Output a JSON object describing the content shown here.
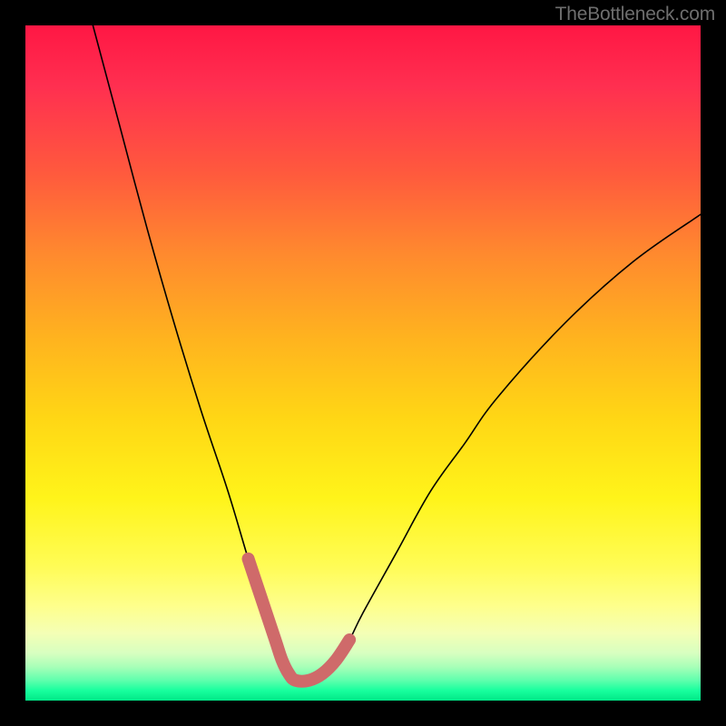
{
  "watermark": "TheBottleneck.com",
  "chart_data": {
    "type": "line",
    "title": "",
    "xlabel": "",
    "ylabel": "",
    "xlim": [
      0,
      100
    ],
    "ylim": [
      0,
      100
    ],
    "series": [
      {
        "name": "bottleneck-curve",
        "x": [
          10,
          14,
          18,
          22,
          26,
          30,
          33,
          35,
          37,
          38,
          39,
          40,
          42,
          44,
          46,
          48,
          50,
          55,
          60,
          65,
          70,
          80,
          90,
          100
        ],
        "values": [
          100,
          85,
          70,
          56,
          43,
          31,
          21,
          15,
          9,
          6,
          4,
          3,
          3,
          4,
          6,
          9,
          13,
          22,
          31,
          38,
          45,
          56,
          65,
          72
        ]
      },
      {
        "name": "highlight-region",
        "x": [
          33,
          35,
          37,
          38,
          39,
          40,
          42,
          44,
          46,
          48
        ],
        "values": [
          21,
          15,
          9,
          6,
          4,
          3,
          3,
          4,
          6,
          9
        ]
      }
    ],
    "gradient_stops": [
      {
        "pos": 0,
        "color": "#ff1744"
      },
      {
        "pos": 0.09,
        "color": "#ff2f50"
      },
      {
        "pos": 0.22,
        "color": "#ff5a3d"
      },
      {
        "pos": 0.34,
        "color": "#ff8a2e"
      },
      {
        "pos": 0.46,
        "color": "#ffb21f"
      },
      {
        "pos": 0.58,
        "color": "#ffd615"
      },
      {
        "pos": 0.7,
        "color": "#fff41a"
      },
      {
        "pos": 0.8,
        "color": "#fffc55"
      },
      {
        "pos": 0.86,
        "color": "#feff8c"
      },
      {
        "pos": 0.9,
        "color": "#f4ffb5"
      },
      {
        "pos": 0.93,
        "color": "#d7ffc0"
      },
      {
        "pos": 0.95,
        "color": "#a8ffb8"
      },
      {
        "pos": 0.97,
        "color": "#5fffad"
      },
      {
        "pos": 0.985,
        "color": "#18ff9e"
      },
      {
        "pos": 1.0,
        "color": "#00e887"
      }
    ],
    "colors": {
      "curve": "#000000",
      "highlight": "#cf6a6a",
      "background_frame": "#000000"
    }
  }
}
